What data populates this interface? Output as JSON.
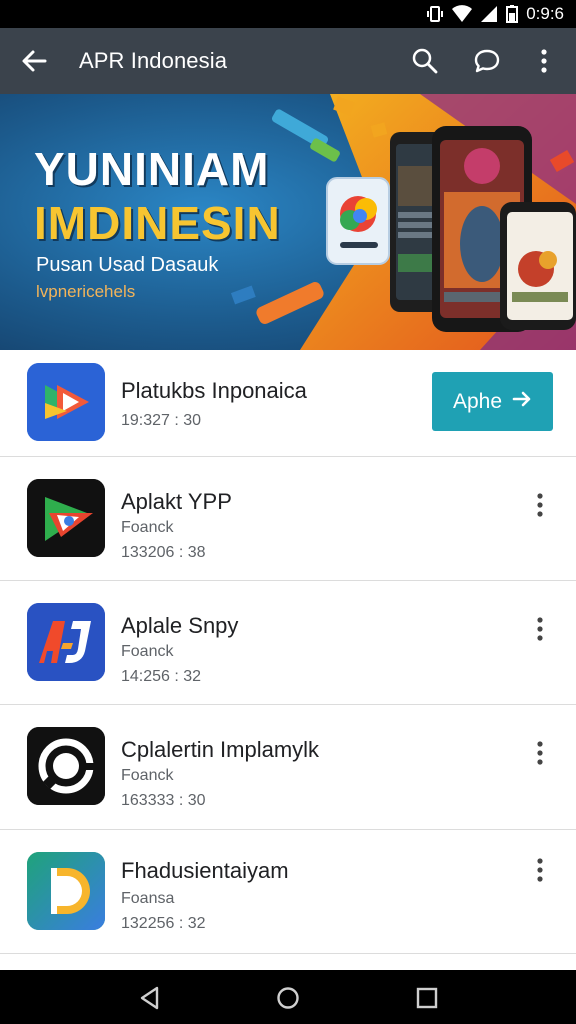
{
  "status_bar": {
    "time": "0:9:6"
  },
  "app_bar": {
    "title": "APR Indonesia"
  },
  "banner": {
    "title_line1": "YUNINIAM",
    "title_line2": "IMDINESIN",
    "subtitle_line1": "Pusan Usad Dasauk",
    "subtitle_line2": "lvpnericehels"
  },
  "apps": [
    {
      "name": "Platukbs Inponaica",
      "sub": "",
      "meta": "19:327 : 30",
      "button": "Aphe"
    },
    {
      "name": "Aplakt YPP",
      "sub": "Foanck",
      "meta": "133206 : 38"
    },
    {
      "name": "Aplale Snpy",
      "sub": "Foanck",
      "meta": "14:256 : 32"
    },
    {
      "name": "Cplalertin Implamylk",
      "sub": "Foanck",
      "meta": "163333 : 30"
    },
    {
      "name": "Fhadusientaiyam",
      "sub": "Foansa",
      "meta": "132256 : 32"
    }
  ],
  "colors": {
    "app_bar": "#3b434c",
    "accent_button": "#1fa1b4",
    "banner_blue": "#1f5e8f",
    "banner_yellow": "#f7c531"
  }
}
